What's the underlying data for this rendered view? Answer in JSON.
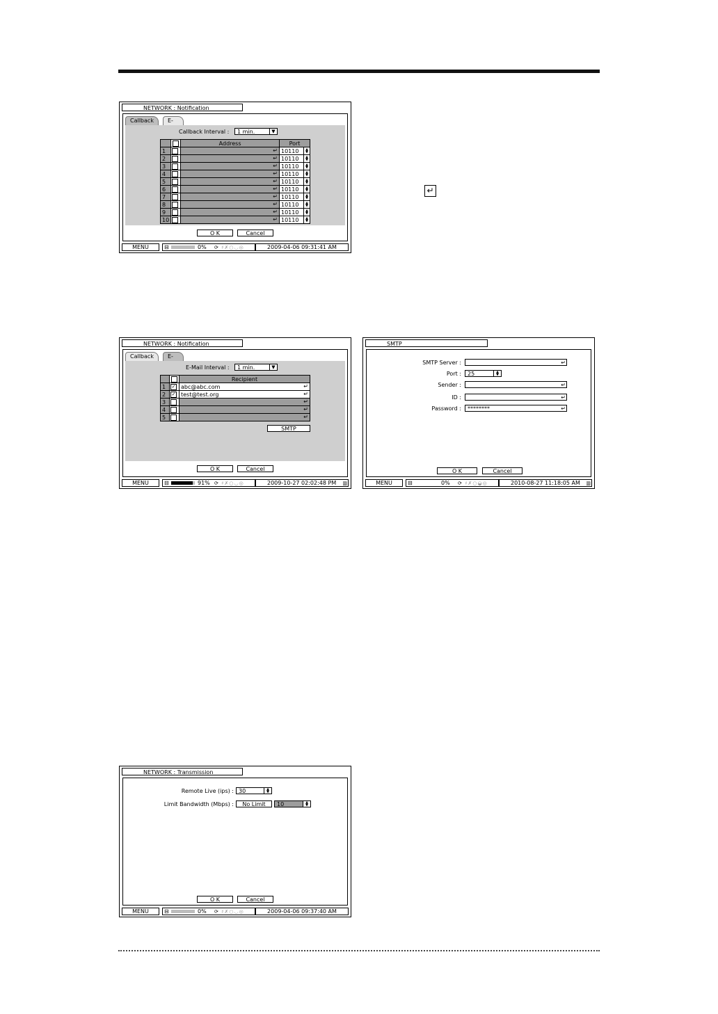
{
  "enter_icon": "enter-key-icon",
  "screen1": {
    "title": "NETWORK : Notification",
    "tabs": [
      "Callback",
      "E-Mail"
    ],
    "interval_label": "Callback Interval :",
    "interval_value": "1 min.",
    "columns": [
      "Address",
      "Port"
    ],
    "rows": [
      {
        "n": "1",
        "port": "10110"
      },
      {
        "n": "2",
        "port": "10110"
      },
      {
        "n": "3",
        "port": "10110"
      },
      {
        "n": "4",
        "port": "10110"
      },
      {
        "n": "5",
        "port": "10110"
      },
      {
        "n": "6",
        "port": "10110"
      },
      {
        "n": "7",
        "port": "10110"
      },
      {
        "n": "8",
        "port": "10110"
      },
      {
        "n": "9",
        "port": "10110"
      },
      {
        "n": "10",
        "port": "10110"
      }
    ],
    "ok": "O K",
    "cancel": "Cancel",
    "status": {
      "menu": "MENU",
      "percent": "0%",
      "percent_value": 0,
      "datetime": "2009-04-06  09:31:41 AM"
    }
  },
  "screen2": {
    "title": "NETWORK : Notification",
    "tabs": [
      "Callback",
      "E-Mail"
    ],
    "interval_label": "E-Mail Interval :",
    "interval_value": "1 min.",
    "columns": [
      "Recipient"
    ],
    "rows": [
      {
        "n": "1",
        "checked": true,
        "recipient": "abc@abc.com"
      },
      {
        "n": "2",
        "checked": true,
        "recipient": "test@test.org"
      },
      {
        "n": "3",
        "checked": false,
        "recipient": ""
      },
      {
        "n": "4",
        "checked": false,
        "recipient": ""
      },
      {
        "n": "5",
        "checked": false,
        "recipient": ""
      }
    ],
    "smtp_button": "SMTP",
    "ok": "O K",
    "cancel": "Cancel",
    "status": {
      "menu": "MENU",
      "percent": "91%",
      "percent_value": 91,
      "datetime": "2009-10-27 02:02:48 PM"
    }
  },
  "screen3": {
    "title": "SMTP",
    "fields": {
      "server_label": "SMTP Server :",
      "server_value": "",
      "port_label": "Port :",
      "port_value": "25",
      "sender_label": "Sender :",
      "sender_value": "",
      "id_label": "ID :",
      "id_value": "",
      "password_label": "Password :",
      "password_value": "********"
    },
    "ok": "O K",
    "cancel": "Cancel",
    "status": {
      "menu": "MENU",
      "percent": "0%",
      "percent_value": 0,
      "datetime": "2010-08-27 11:18:05 AM"
    }
  },
  "screen4": {
    "title": "NETWORK : Transmission",
    "remote_live_label": "Remote Live (ips) :",
    "remote_live_value": "30",
    "bandwidth_label": "Limit Bandwidth (Mbps) :",
    "no_limit_label": "No Limit",
    "bandwidth_value": "10",
    "ok": "O K",
    "cancel": "Cancel",
    "status": {
      "menu": "MENU",
      "percent": "0%",
      "percent_value": 0,
      "datetime": "2009-04-06  09:37:40 AM"
    }
  }
}
